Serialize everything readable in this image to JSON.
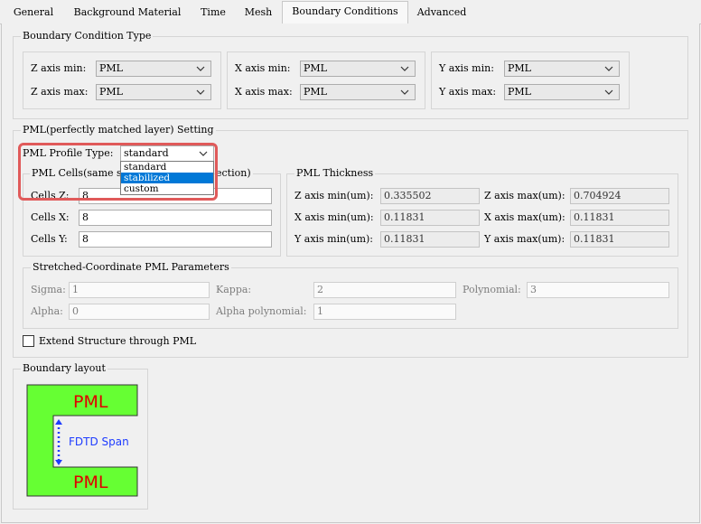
{
  "tabs": [
    {
      "label": "General"
    },
    {
      "label": "Background Material"
    },
    {
      "label": "Time"
    },
    {
      "label": "Mesh"
    },
    {
      "label": "Boundary Conditions"
    },
    {
      "label": "Advanced"
    }
  ],
  "active_tab": "Boundary Conditions",
  "boundary_type": {
    "title": "Boundary Condition Type",
    "z_min_label": "Z axis min:",
    "z_min": "PML",
    "z_max_label": "Z axis max:",
    "z_max": "PML",
    "x_min_label": "X axis min:",
    "x_min": "PML",
    "x_max_label": "X axis max:",
    "x_max": "PML",
    "y_min_label": "Y axis min:",
    "y_min": "PML",
    "y_max_label": "Y axis max:",
    "y_max": "PML"
  },
  "pml_setting": {
    "title": "PML(perfectly matched layer) Setting",
    "profile_label": "PML Profile Type:",
    "profile_value": "standard",
    "profile_options": [
      "standard",
      "stabilized",
      "custom"
    ],
    "profile_selected_option": "stabilized",
    "cells": {
      "title_left": "PML Cells(same s",
      "title_right": "ection)",
      "z_label": "Cells Z:",
      "z": "8",
      "x_label": "Cells X:",
      "x": "8",
      "y_label": "Cells Y:",
      "y": "8"
    },
    "thickness": {
      "title": "PML Thickness",
      "z_min_label": "Z axis min(um):",
      "z_min": "0.335502",
      "z_max_label": "Z axis max(um):",
      "z_max": "0.704924",
      "x_min_label": "X axis min(um):",
      "x_min": "0.11831",
      "x_max_label": "X axis max(um):",
      "x_max": "0.11831",
      "y_min_label": "Y axis min(um):",
      "y_min": "0.11831",
      "y_max_label": "Y axis max(um):",
      "y_max": "0.11831"
    },
    "stretched": {
      "title": "Stretched-Coordinate PML Parameters",
      "sigma_label": "Sigma:",
      "sigma": "1",
      "kappa_label": "Kappa:",
      "kappa": "2",
      "polynomial_label": "Polynomial:",
      "polynomial": "3",
      "alpha_label": "Alpha:",
      "alpha": "0",
      "alpha_poly_label": "Alpha polynomial:",
      "alpha_poly": "1"
    },
    "extend_label": "Extend Structure through PML",
    "extend_checked": false
  },
  "boundary_layout": {
    "title": "Boundary layout",
    "top_label": "PML",
    "bottom_label": "PML",
    "span_label": "FDTD Span"
  },
  "colors": {
    "pml_green": "#66ff33",
    "pml_text": "#e00000",
    "span_text": "#1e3cff",
    "highlight": "#e05a5a",
    "selection": "#0078d7"
  }
}
